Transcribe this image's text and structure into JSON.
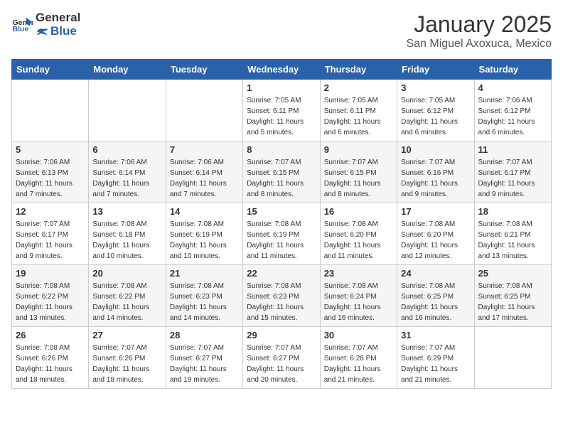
{
  "header": {
    "logo_general": "General",
    "logo_blue": "Blue",
    "month": "January 2025",
    "location": "San Miguel Axoxuca, Mexico"
  },
  "days_of_week": [
    "Sunday",
    "Monday",
    "Tuesday",
    "Wednesday",
    "Thursday",
    "Friday",
    "Saturday"
  ],
  "weeks": [
    [
      {
        "day": "",
        "sunrise": "",
        "sunset": "",
        "daylight": ""
      },
      {
        "day": "",
        "sunrise": "",
        "sunset": "",
        "daylight": ""
      },
      {
        "day": "",
        "sunrise": "",
        "sunset": "",
        "daylight": ""
      },
      {
        "day": "1",
        "sunrise": "Sunrise: 7:05 AM",
        "sunset": "Sunset: 6:11 PM",
        "daylight": "Daylight: 11 hours and 5 minutes."
      },
      {
        "day": "2",
        "sunrise": "Sunrise: 7:05 AM",
        "sunset": "Sunset: 6:11 PM",
        "daylight": "Daylight: 11 hours and 6 minutes."
      },
      {
        "day": "3",
        "sunrise": "Sunrise: 7:05 AM",
        "sunset": "Sunset: 6:12 PM",
        "daylight": "Daylight: 11 hours and 6 minutes."
      },
      {
        "day": "4",
        "sunrise": "Sunrise: 7:06 AM",
        "sunset": "Sunset: 6:12 PM",
        "daylight": "Daylight: 11 hours and 6 minutes."
      }
    ],
    [
      {
        "day": "5",
        "sunrise": "Sunrise: 7:06 AM",
        "sunset": "Sunset: 6:13 PM",
        "daylight": "Daylight: 11 hours and 7 minutes."
      },
      {
        "day": "6",
        "sunrise": "Sunrise: 7:06 AM",
        "sunset": "Sunset: 6:14 PM",
        "daylight": "Daylight: 11 hours and 7 minutes."
      },
      {
        "day": "7",
        "sunrise": "Sunrise: 7:06 AM",
        "sunset": "Sunset: 6:14 PM",
        "daylight": "Daylight: 11 hours and 7 minutes."
      },
      {
        "day": "8",
        "sunrise": "Sunrise: 7:07 AM",
        "sunset": "Sunset: 6:15 PM",
        "daylight": "Daylight: 11 hours and 8 minutes."
      },
      {
        "day": "9",
        "sunrise": "Sunrise: 7:07 AM",
        "sunset": "Sunset: 6:15 PM",
        "daylight": "Daylight: 11 hours and 8 minutes."
      },
      {
        "day": "10",
        "sunrise": "Sunrise: 7:07 AM",
        "sunset": "Sunset: 6:16 PM",
        "daylight": "Daylight: 11 hours and 9 minutes."
      },
      {
        "day": "11",
        "sunrise": "Sunrise: 7:07 AM",
        "sunset": "Sunset: 6:17 PM",
        "daylight": "Daylight: 11 hours and 9 minutes."
      }
    ],
    [
      {
        "day": "12",
        "sunrise": "Sunrise: 7:07 AM",
        "sunset": "Sunset: 6:17 PM",
        "daylight": "Daylight: 11 hours and 9 minutes."
      },
      {
        "day": "13",
        "sunrise": "Sunrise: 7:08 AM",
        "sunset": "Sunset: 6:18 PM",
        "daylight": "Daylight: 11 hours and 10 minutes."
      },
      {
        "day": "14",
        "sunrise": "Sunrise: 7:08 AM",
        "sunset": "Sunset: 6:19 PM",
        "daylight": "Daylight: 11 hours and 10 minutes."
      },
      {
        "day": "15",
        "sunrise": "Sunrise: 7:08 AM",
        "sunset": "Sunset: 6:19 PM",
        "daylight": "Daylight: 11 hours and 11 minutes."
      },
      {
        "day": "16",
        "sunrise": "Sunrise: 7:08 AM",
        "sunset": "Sunset: 6:20 PM",
        "daylight": "Daylight: 11 hours and 11 minutes."
      },
      {
        "day": "17",
        "sunrise": "Sunrise: 7:08 AM",
        "sunset": "Sunset: 6:20 PM",
        "daylight": "Daylight: 11 hours and 12 minutes."
      },
      {
        "day": "18",
        "sunrise": "Sunrise: 7:08 AM",
        "sunset": "Sunset: 6:21 PM",
        "daylight": "Daylight: 11 hours and 13 minutes."
      }
    ],
    [
      {
        "day": "19",
        "sunrise": "Sunrise: 7:08 AM",
        "sunset": "Sunset: 6:22 PM",
        "daylight": "Daylight: 11 hours and 13 minutes."
      },
      {
        "day": "20",
        "sunrise": "Sunrise: 7:08 AM",
        "sunset": "Sunset: 6:22 PM",
        "daylight": "Daylight: 11 hours and 14 minutes."
      },
      {
        "day": "21",
        "sunrise": "Sunrise: 7:08 AM",
        "sunset": "Sunset: 6:23 PM",
        "daylight": "Daylight: 11 hours and 14 minutes."
      },
      {
        "day": "22",
        "sunrise": "Sunrise: 7:08 AM",
        "sunset": "Sunset: 6:23 PM",
        "daylight": "Daylight: 11 hours and 15 minutes."
      },
      {
        "day": "23",
        "sunrise": "Sunrise: 7:08 AM",
        "sunset": "Sunset: 6:24 PM",
        "daylight": "Daylight: 11 hours and 16 minutes."
      },
      {
        "day": "24",
        "sunrise": "Sunrise: 7:08 AM",
        "sunset": "Sunset: 6:25 PM",
        "daylight": "Daylight: 11 hours and 16 minutes."
      },
      {
        "day": "25",
        "sunrise": "Sunrise: 7:08 AM",
        "sunset": "Sunset: 6:25 PM",
        "daylight": "Daylight: 11 hours and 17 minutes."
      }
    ],
    [
      {
        "day": "26",
        "sunrise": "Sunrise: 7:08 AM",
        "sunset": "Sunset: 6:26 PM",
        "daylight": "Daylight: 11 hours and 18 minutes."
      },
      {
        "day": "27",
        "sunrise": "Sunrise: 7:07 AM",
        "sunset": "Sunset: 6:26 PM",
        "daylight": "Daylight: 11 hours and 18 minutes."
      },
      {
        "day": "28",
        "sunrise": "Sunrise: 7:07 AM",
        "sunset": "Sunset: 6:27 PM",
        "daylight": "Daylight: 11 hours and 19 minutes."
      },
      {
        "day": "29",
        "sunrise": "Sunrise: 7:07 AM",
        "sunset": "Sunset: 6:27 PM",
        "daylight": "Daylight: 11 hours and 20 minutes."
      },
      {
        "day": "30",
        "sunrise": "Sunrise: 7:07 AM",
        "sunset": "Sunset: 6:28 PM",
        "daylight": "Daylight: 11 hours and 21 minutes."
      },
      {
        "day": "31",
        "sunrise": "Sunrise: 7:07 AM",
        "sunset": "Sunset: 6:29 PM",
        "daylight": "Daylight: 11 hours and 21 minutes."
      },
      {
        "day": "",
        "sunrise": "",
        "sunset": "",
        "daylight": ""
      }
    ]
  ]
}
